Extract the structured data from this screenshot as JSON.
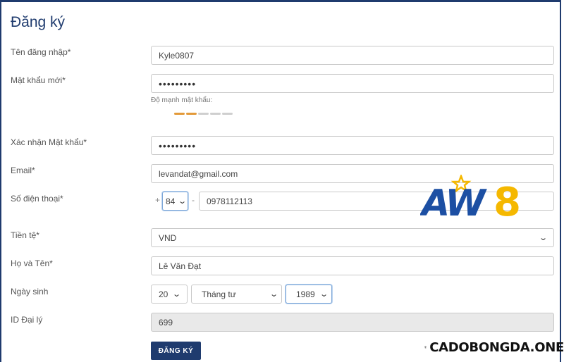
{
  "form": {
    "title": "Đăng ký",
    "fields": {
      "username": {
        "label": "Tên đăng nhập*",
        "value": "Kyle0807"
      },
      "password": {
        "label": "Mật khẩu mới*",
        "value": "•••••••••"
      },
      "strength": {
        "label": "Độ mạnh mật khẩu:",
        "level": 2,
        "total": 5,
        "active_color": "#e39a3a",
        "inactive_color": "#cfcfcf"
      },
      "confirm_password": {
        "label": "Xác nhận Mật khẩu*",
        "value": "•••••••••"
      },
      "email": {
        "label": "Email*",
        "value": "levandat@gmail.com"
      },
      "phone": {
        "label": "Số điện thoại*",
        "plus": "+",
        "country_code": "84",
        "separator": "-",
        "number": "0978112113"
      },
      "currency": {
        "label": "Tiền tệ*",
        "value": "VND"
      },
      "full_name": {
        "label": "Họ và Tên*",
        "value": "Lê Văn Đạt"
      },
      "birthday": {
        "label": "Ngày sinh",
        "day": "20",
        "month": "Tháng tư",
        "year": "1989"
      },
      "agent_id": {
        "label": "ID Đại lý",
        "value": "699"
      }
    },
    "submit_label": "ĐĂNG KÝ"
  },
  "branding": {
    "aw8_logo": "AW8",
    "watermark": "CADOBONGDA.ONE"
  },
  "colors": {
    "primary": "#1f3b6e",
    "logo_blue": "#1c4fa3",
    "logo_yellow": "#f5b800"
  }
}
